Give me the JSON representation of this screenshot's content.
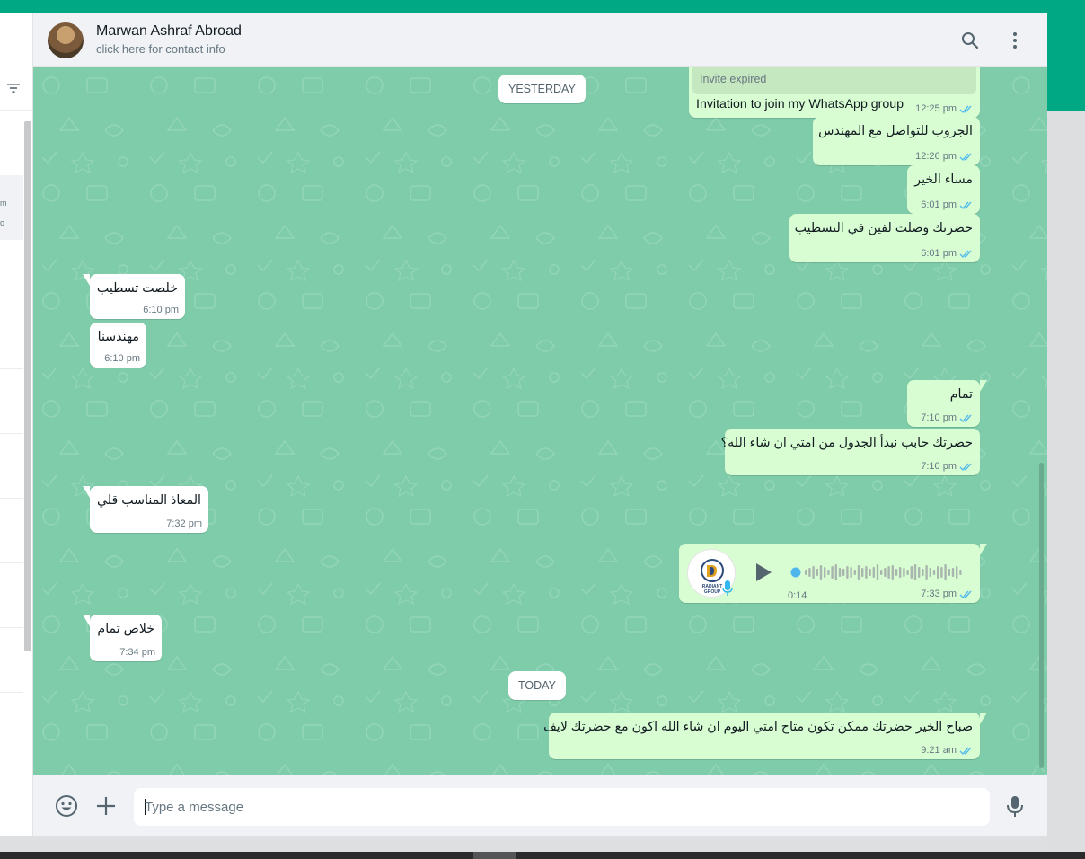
{
  "colors": {
    "accent": "#00a884",
    "outgoing": "#d9fdd3",
    "incoming": "#ffffff",
    "chat_bg": "#7fccaa",
    "tick_read": "#53bdeb"
  },
  "header": {
    "contact_name": "Marwan Ashraf Abroad",
    "contact_sub": "click here for contact info",
    "icons": [
      "search-icon",
      "menu-dots-icon"
    ]
  },
  "sidebar": {
    "selected_snippet": "m\no"
  },
  "dates": {
    "yesterday": "YESTERDAY",
    "today": "TODAY"
  },
  "messages": [
    {
      "dir": "out",
      "invite": "Invite expired",
      "text": "Invitation to join my WhatsApp group",
      "time": "12:25 pm"
    },
    {
      "dir": "out",
      "text": "الجروب للتواصل مع المهندس",
      "time": "12:26 pm"
    },
    {
      "dir": "out",
      "text": "مساء الخير",
      "time": "6:01 pm"
    },
    {
      "dir": "out",
      "text": "حضرتك وصلت لفين في التسطيب",
      "time": "6:01 pm"
    },
    {
      "dir": "in",
      "text": "خلصت تسطيب",
      "time": "6:10 pm"
    },
    {
      "dir": "in",
      "text": "مهندسنا",
      "time": "6:10 pm"
    },
    {
      "dir": "out",
      "text": "تمام",
      "time": "7:10 pm"
    },
    {
      "dir": "out",
      "text": "حضرتك حابب نبدأ الجدول من امتي ان شاء الله؟",
      "time": "7:10 pm"
    },
    {
      "dir": "in",
      "text": "المعاذ المناسب قلي",
      "time": "7:32 pm"
    },
    {
      "dir": "out",
      "voice": true,
      "duration": "0:14",
      "time": "7:33 pm",
      "voice_brand": "RADIANT GROUP"
    },
    {
      "dir": "in",
      "text": "خلاص تمام",
      "time": "7:34 pm"
    },
    {
      "dir": "out",
      "text": "صباح الخير حضرتك ممكن تكون متاح امتي اليوم ان شاء الله اكون مع حضرتك لايف",
      "time": "9:21 am"
    }
  ],
  "compose": {
    "placeholder": "Type a message",
    "icons": [
      "emoji-icon",
      "attach-plus-icon",
      "mic-icon"
    ]
  }
}
